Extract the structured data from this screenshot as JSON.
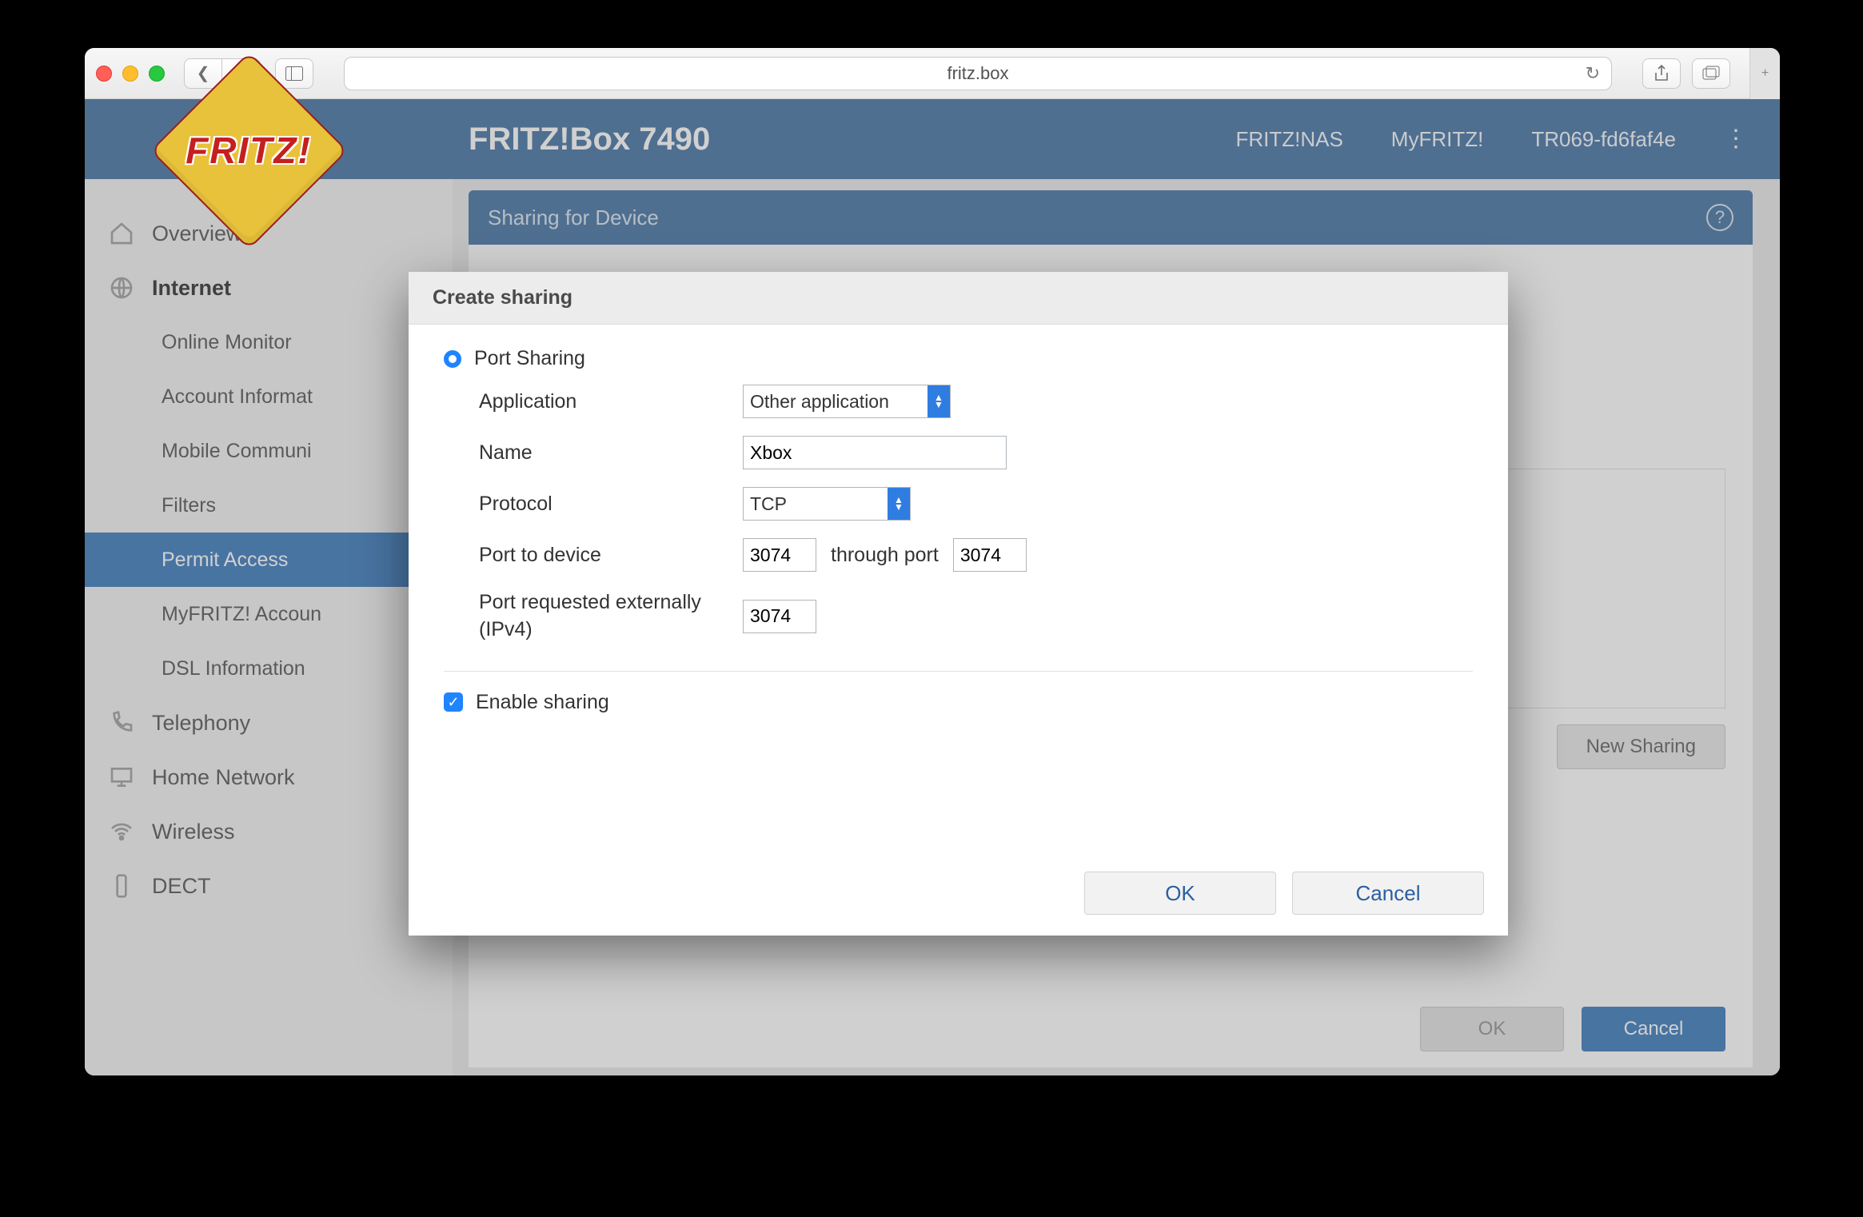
{
  "browser": {
    "address": "fritz.box"
  },
  "header": {
    "title": "FRITZ!Box 7490",
    "logo_text": "FRITZ!",
    "links": {
      "nas": "FRITZ!NAS",
      "myfritz": "MyFRITZ!",
      "user": "TR069-fd6faf4e"
    }
  },
  "subheader": {
    "title": "Sharing for Device"
  },
  "sidebar": {
    "overview": "Overview",
    "internet": "Internet",
    "internet_items": {
      "online_monitor": "Online Monitor",
      "account_info": "Account Informat",
      "mobile": "Mobile Communi",
      "filters": "Filters",
      "permit_access": "Permit Access",
      "myfritz_account": "MyFRITZ! Accoun",
      "dsl_info": "DSL Information"
    },
    "telephony": "Telephony",
    "home_network": "Home Network",
    "wireless": "Wireless",
    "dect": "DECT"
  },
  "panel": {
    "new_sharing": "New Sharing",
    "ok": "OK",
    "cancel": "Cancel"
  },
  "modal": {
    "title": "Create sharing",
    "radio_label": "Port Sharing",
    "labels": {
      "application": "Application",
      "name": "Name",
      "protocol": "Protocol",
      "port_to_device": "Port to device",
      "through_port": "through port",
      "port_external": "Port requested externally (IPv4)"
    },
    "values": {
      "application": "Other application",
      "name": "Xbox",
      "protocol": "TCP",
      "port_from": "3074",
      "port_to": "3074",
      "port_ext": "3074"
    },
    "enable_sharing": "Enable sharing",
    "ok": "OK",
    "cancel": "Cancel"
  }
}
